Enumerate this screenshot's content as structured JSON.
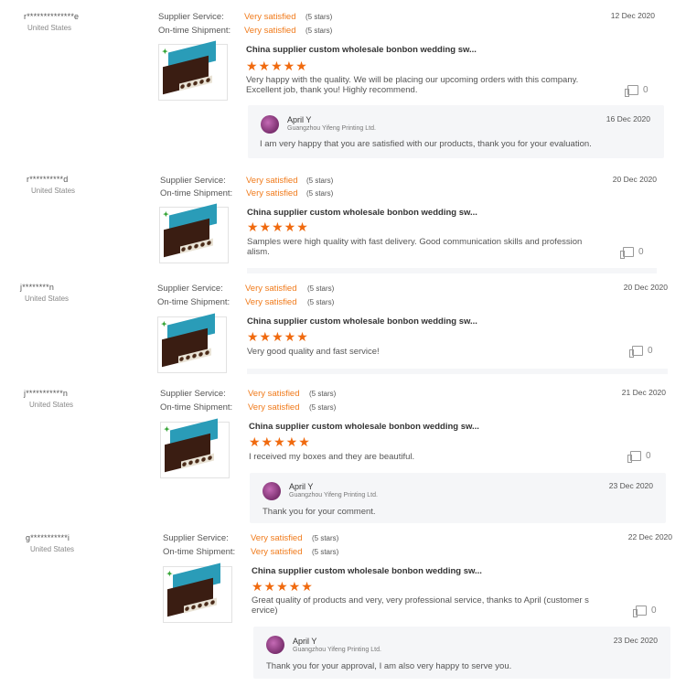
{
  "labels": {
    "supplier_service": "Supplier Service:",
    "ontime_shipment": "On-time Shipment:",
    "stars_five": "(5 stars)",
    "star_glyphs": "★★★★★"
  },
  "icons": {
    "like": "thumbs-up-icon",
    "avatar": "avatar-icon"
  },
  "colors": {
    "accent": "#f07a1a",
    "stars": "#f06a0f",
    "reply_bg": "#f5f6f8"
  },
  "reviews": [
    {
      "buyer": "r**************e",
      "country": "United States",
      "supplier_service": "Very satisfied",
      "ontime_shipment": "Very satisfied",
      "date": "12 Dec 2020",
      "product": "China supplier custom wholesale bonbon wedding sw...",
      "rating": 5,
      "comment": "Very happy with the quality. We will be placing our upcoming orders with this company. Excellent job, thank you! Highly recommend.",
      "likes": "0",
      "reply": {
        "name": "April Y",
        "company": "Guangzhou Yifeng Printing Ltd.",
        "date": "16 Dec 2020",
        "text": "I am very happy that you are satisfied with our products, thank you for your evaluation."
      }
    },
    {
      "buyer": "r**********d",
      "country": "United States",
      "supplier_service": "Very satisfied",
      "ontime_shipment": "Very satisfied",
      "date": "20 Dec 2020",
      "product": "China supplier custom wholesale bonbon wedding sw...",
      "rating": 5,
      "comment": "Samples were high quality with fast delivery. Good communication skills and professionalism.",
      "likes": "0"
    },
    {
      "buyer": "j********n",
      "country": "United States",
      "supplier_service": "Very satisfied",
      "ontime_shipment": "Very satisfied",
      "date": "20 Dec 2020",
      "product": "China supplier custom wholesale bonbon wedding sw...",
      "rating": 5,
      "comment": "Very good quality and fast service!",
      "likes": "0"
    },
    {
      "buyer": "j***********n",
      "country": "United States",
      "supplier_service": "Very satisfied",
      "ontime_shipment": "Very satisfied",
      "date": "21 Dec 2020",
      "product": "China supplier custom wholesale bonbon wedding sw...",
      "rating": 5,
      "comment": "I received my boxes and they are beautiful.",
      "likes": "0",
      "reply": {
        "name": "April Y",
        "company": "Guangzhou Yifeng Printing Ltd.",
        "date": "23 Dec 2020",
        "text": "Thank you for your comment."
      }
    },
    {
      "buyer": "g***********i",
      "country": "United States",
      "supplier_service": "Very satisfied",
      "ontime_shipment": "Very satisfied",
      "date": "22 Dec 2020",
      "product": "China supplier custom wholesale bonbon wedding sw...",
      "rating": 5,
      "comment": "Great quality of products and very, very professional service, thanks to April (customer service)",
      "likes": "0",
      "reply": {
        "name": "April Y",
        "company": "Guangzhou Yifeng Printing Ltd.",
        "date": "23 Dec 2020",
        "text": "Thank you for your approval, I am also very happy to serve you."
      }
    }
  ]
}
